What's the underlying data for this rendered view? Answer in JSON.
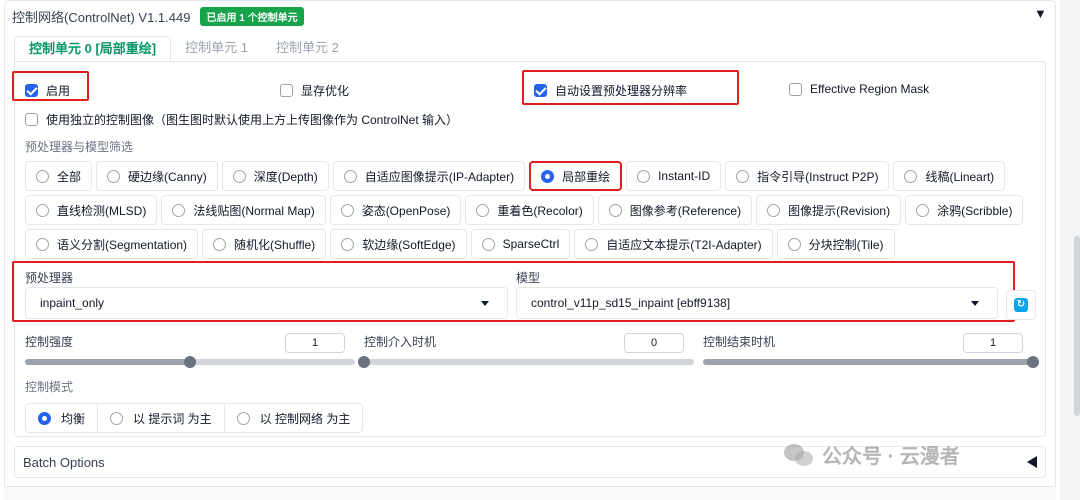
{
  "header": {
    "title": "控制网络(ControlNet) V1.1.449",
    "badge": "已启用 1 个控制单元",
    "collapse_icon": "▼"
  },
  "tabs": [
    {
      "label": "控制单元 0 [局部重绘]",
      "active": true
    },
    {
      "label": "控制单元 1",
      "active": false
    },
    {
      "label": "控制单元 2",
      "active": false
    }
  ],
  "options": {
    "enable": {
      "label": "启用",
      "checked": true
    },
    "low_vram": {
      "label": "显存优化",
      "checked": false
    },
    "pixel_perfect": {
      "label": "自动设置预处理器分辨率",
      "checked": true
    },
    "effective_region_mask": {
      "label": "Effective Region Mask",
      "checked": false
    },
    "independent_image": {
      "label": "使用独立的控制图像（图生图时默认使用上方上传图像作为 ControlNet 输入）",
      "checked": false
    }
  },
  "filter": {
    "label": "预处理器与模型筛选",
    "rows": [
      [
        "全部",
        "硬边缘(Canny)",
        "深度(Depth)",
        "自适应图像提示(IP-Adapter)",
        "局部重绘",
        "Instant-ID",
        "指令引导(Instruct P2P)",
        "线稿(Lineart)"
      ],
      [
        "直线检测(MLSD)",
        "法线贴图(Normal Map)",
        "姿态(OpenPose)",
        "重着色(Recolor)",
        "图像参考(Reference)",
        "图像提示(Revision)",
        "涂鸦(Scribble)"
      ],
      [
        "语义分割(Segmentation)",
        "随机化(Shuffle)",
        "软边缘(SoftEdge)",
        "SparseCtrl",
        "自适应文本提示(T2I-Adapter)",
        "分块控制(Tile)"
      ]
    ],
    "selected": "局部重绘"
  },
  "preprocessor": {
    "label": "预处理器",
    "value": "inpaint_only"
  },
  "model": {
    "label": "模型",
    "value": "control_v11p_sd15_inpaint [ebff9138]"
  },
  "sliders": {
    "weight": {
      "label": "控制强度",
      "value": "1",
      "fraction": 0.5
    },
    "start": {
      "label": "控制介入时机",
      "value": "0",
      "fraction": 0.0
    },
    "end": {
      "label": "控制结束时机",
      "value": "1",
      "fraction": 1.0
    }
  },
  "control_mode": {
    "label": "控制模式",
    "options": [
      "均衡",
      "以 提示词 为主",
      "以 控制网络 为主"
    ],
    "selected": "均衡"
  },
  "batch": {
    "label": "Batch Options"
  },
  "watermark": {
    "text": "公众号 · 云漫者"
  },
  "colors": {
    "accent": "#2563eb",
    "badge": "#16a34a",
    "highlight": "#e11d1d",
    "tab_active": "#059669"
  }
}
